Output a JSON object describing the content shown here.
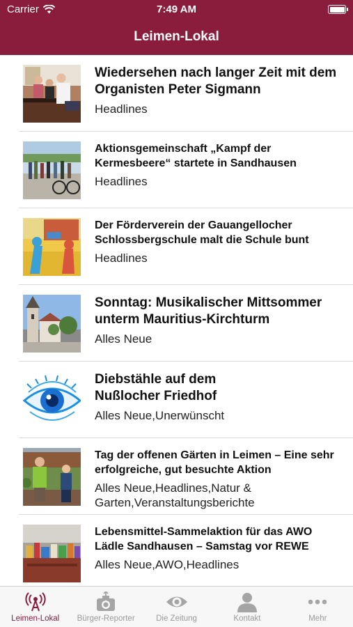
{
  "status_bar": {
    "carrier": "Carrier",
    "time": "7:49 AM"
  },
  "nav": {
    "title": "Leimen-Lokal"
  },
  "articles": [
    {
      "title": "Wiedersehen nach langer Zeit mit dem Organisten Peter Sigmann",
      "categories": "Headlines",
      "image": "organ-photo"
    },
    {
      "title": "Aktionsgemeinschaft „Kampf der Kermesbeere“ startete in Sandhausen",
      "categories": "Headlines",
      "image": "group-photo"
    },
    {
      "title": "Der Förderverein der Gauangellocher Schlossbergschule malt die Schule bunt",
      "categories": "Headlines",
      "image": "painting-photo"
    },
    {
      "title": "Sonntag: Musikalischer Mittsommer unterm Mauritius-Kirchturm",
      "categories": "Alles Neue",
      "image": "church-photo"
    },
    {
      "title": "Diebstähle auf dem Nußlocher Friedhof",
      "categories": "Alles Neue,Unerwünscht",
      "image": "eye-graphic"
    },
    {
      "title": "Tag der offenen Gärten in Leimen – Eine sehr erfolgreiche, gut besuchte Aktion",
      "categories": "Alles Neue,Headlines,Natur & Garten,Veranstaltungsberichte",
      "image": "garden-photo"
    },
    {
      "title": "Lebensmittel-Sammelaktion für das AWO Lädle Sandhausen – Samstag vor REWE",
      "categories": "Alles Neue,AWO,Headlines",
      "image": "food-photo"
    }
  ],
  "tabs": [
    {
      "label": "Leimen-Lokal",
      "icon": "antenna-icon",
      "active": true
    },
    {
      "label": "Bürger-Reporter",
      "icon": "camera-icon",
      "active": false
    },
    {
      "label": "Die Zeitung",
      "icon": "eye-icon",
      "active": false
    },
    {
      "label": "Kontakt",
      "icon": "person-icon",
      "active": false
    },
    {
      "label": "Mehr",
      "icon": "more-icon",
      "active": false
    }
  ],
  "colors": {
    "brand": "#8a1c3c",
    "tab_inactive": "#9a9a9a"
  }
}
